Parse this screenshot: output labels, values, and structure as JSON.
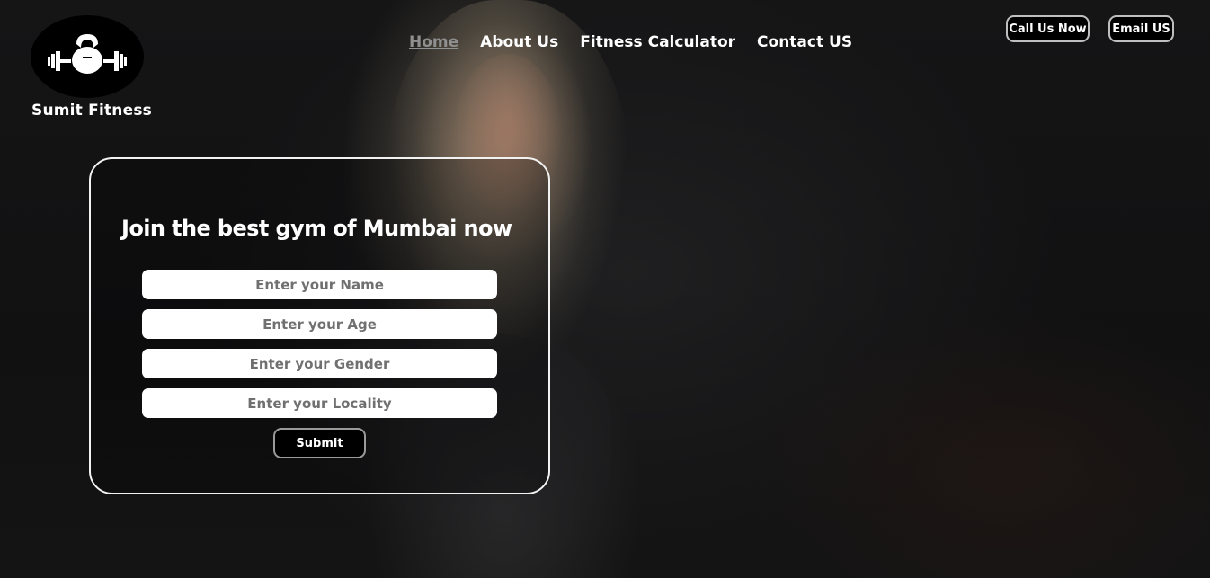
{
  "brand": {
    "name": "Sumit Fitness",
    "logo_icon": "kettlebell-barbell-icon"
  },
  "nav": {
    "items": [
      {
        "label": "Home",
        "active": true
      },
      {
        "label": "About Us",
        "active": false
      },
      {
        "label": "Fitness Calculator",
        "active": false
      },
      {
        "label": "Contact US",
        "active": false
      }
    ]
  },
  "header_buttons": {
    "call": "Call Us Now",
    "email": "Email US"
  },
  "form": {
    "title": "Join the best gym of Mumbai now",
    "name_placeholder": "Enter your Name",
    "age_placeholder": "Enter your Age",
    "gender_placeholder": "Enter your Gender",
    "locality_placeholder": "Enter your Locality",
    "submit_label": "Submit"
  },
  "colors": {
    "background": "#0d0d0e",
    "text": "#ffffff",
    "active_nav": "#8f8f8f",
    "field_bg": "#ffffff"
  }
}
